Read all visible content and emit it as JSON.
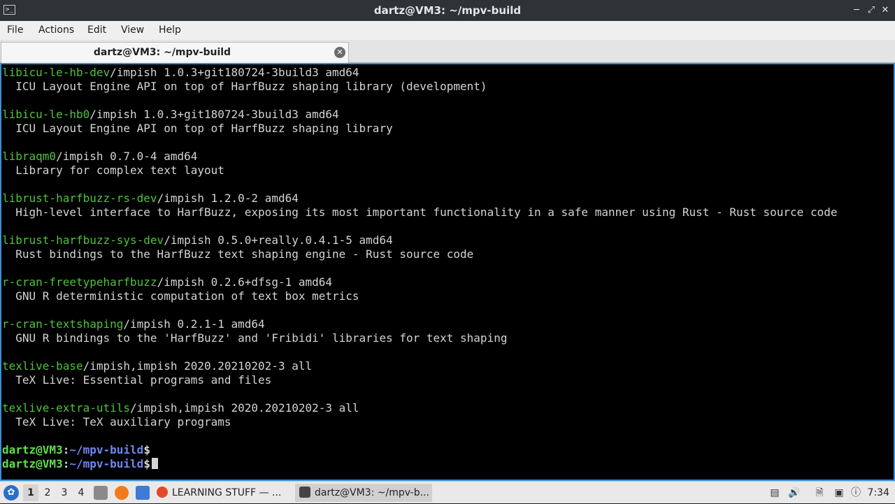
{
  "window": {
    "title": "dartz@VM3: ~/mpv-build",
    "icon": "terminal-icon",
    "minimize": "minimize-icon",
    "maximize": "maximize-icon",
    "close": "close-icon"
  },
  "menu": {
    "items": [
      "File",
      "Actions",
      "Edit",
      "View",
      "Help"
    ]
  },
  "tab": {
    "label": "dartz@VM3: ~/mpv-build",
    "close_icon": "close-circle-icon"
  },
  "terminal": {
    "entries": [
      {
        "pkg": "libicu-le-hb-dev",
        "rest": "/impish 1.0.3+git180724-3build3 amd64",
        "desc": "  ICU Layout Engine API on top of HarfBuzz shaping library (development)"
      },
      {
        "pkg": "libicu-le-hb0",
        "rest": "/impish 1.0.3+git180724-3build3 amd64",
        "desc": "  ICU Layout Engine API on top of HarfBuzz shaping library"
      },
      {
        "pkg": "libraqm0",
        "rest": "/impish 0.7.0-4 amd64",
        "desc": "  Library for complex text layout"
      },
      {
        "pkg": "librust-harfbuzz-rs-dev",
        "rest": "/impish 1.2.0-2 amd64",
        "desc": "  High-level interface to HarfBuzz, exposing its most important functionality in a safe manner using Rust - Rust source code"
      },
      {
        "pkg": "librust-harfbuzz-sys-dev",
        "rest": "/impish 0.5.0+really.0.4.1-5 amd64",
        "desc": "  Rust bindings to the HarfBuzz text shaping engine - Rust source code"
      },
      {
        "pkg": "r-cran-freetypeharfbuzz",
        "rest": "/impish 0.2.6+dfsg-1 amd64",
        "desc": "  GNU R deterministic computation of text box metrics"
      },
      {
        "pkg": "r-cran-textshaping",
        "rest": "/impish 0.2.1-1 amd64",
        "desc": "  GNU R bindings to the 'HarfBuzz' and 'Fribidi' libraries for text shaping"
      },
      {
        "pkg": "texlive-base",
        "rest": "/impish,impish 2020.20210202-3 all",
        "desc": "  TeX Live: Essential programs and files"
      },
      {
        "pkg": "texlive-extra-utils",
        "rest": "/impish,impish 2020.20210202-3 all",
        "desc": "  TeX Live: TeX auxiliary programs"
      }
    ],
    "prompts": [
      {
        "user": "dartz@VM3",
        "sep": ":",
        "path": "~/mpv-build",
        "dollar": "$"
      },
      {
        "user": "dartz@VM3",
        "sep": ":",
        "path": "~/mpv-build",
        "dollar": "$"
      }
    ]
  },
  "taskbar": {
    "start_icon": "lubuntu-start-icon",
    "workspaces": [
      "1",
      "2",
      "3",
      "4"
    ],
    "active_workspace": "1",
    "launchers": [
      "file-manager-icon",
      "firefox-icon",
      "desktop-icon"
    ],
    "tasks": [
      {
        "label": "LEARNING STUFF — ...",
        "icon": "firefox-icon"
      },
      {
        "label": "dartz@VM3: ~/mpv-b...",
        "icon": "terminal-icon"
      }
    ],
    "tray": [
      "notes-icon",
      "volume-icon",
      "files-icon",
      "network-icon",
      "update-icon"
    ],
    "clock": "7:34"
  },
  "colors": {
    "terminal_bg": "#000000",
    "pkg_name": "#4fc23c",
    "prompt_user": "#5fe04a",
    "prompt_path": "#6f86f0",
    "accent_border": "#3b8fd9"
  }
}
